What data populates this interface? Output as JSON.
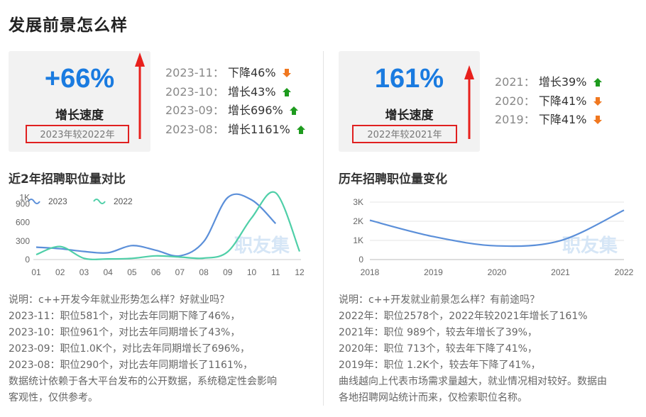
{
  "page_title": "发展前景怎么样",
  "left": {
    "stat": {
      "value": "+66%",
      "label": "增长速度",
      "compare": "2023年较2022年"
    },
    "trends": [
      {
        "period": "2023-11：",
        "text": "下降46%",
        "dir": "down"
      },
      {
        "period": "2023-10：",
        "text": "增长43%",
        "dir": "up"
      },
      {
        "period": "2023-09：",
        "text": "增长696%",
        "dir": "up"
      },
      {
        "period": "2023-08：",
        "text": "增长1161%",
        "dir": "up"
      }
    ],
    "section_title": "近2年招聘职位量对比",
    "description": [
      "说明：c++开发今年就业形势怎么样？好就业吗？",
      "2023-11：职位581个，对比去年同期下降了46%，",
      "2023-10：职位961个，对比去年同期增长了43%，",
      "2023-09：职位1.0K个，对比去年同期增长了696%，",
      "2023-08：职位290个，对比去年同期增长了1161%，",
      "数据统计依赖于各大平台发布的公开数据，系统稳定性会影响",
      "客观性，仅供参考。"
    ]
  },
  "right": {
    "stat": {
      "value": "161%",
      "label": "增长速度",
      "compare": "2022年较2021年"
    },
    "trends": [
      {
        "period": "2021：",
        "text": "增长39%",
        "dir": "up"
      },
      {
        "period": "2020：",
        "text": "下降41%",
        "dir": "down"
      },
      {
        "period": "2019：",
        "text": "下降41%",
        "dir": "down"
      }
    ],
    "section_title": "历年招聘职位量变化",
    "description": [
      "说明：c++开发就业前景怎么样？有前途吗？",
      "2022年：职位2578个，2022年较2021年增长了161%",
      "2021年：职位 989个，较去年增长了39%，",
      "2020年：职位 713个，较去年下降了41%，",
      "2019年：职位 1.2K个，较去年下降了41%，",
      "曲线越向上代表市场需求量越大，就业情况相对较好。数据由",
      "各地招聘网站统计而来，仅检索职位名称。"
    ]
  },
  "colors": {
    "up": "#1e9b1e",
    "down": "#f07820",
    "accent": "#1a7be0",
    "series_2023": "#5b8fd9",
    "series_2022": "#4fcfa8"
  },
  "watermark": "职友集",
  "chart_data": [
    {
      "type": "line",
      "title": "近2年招聘职位量对比",
      "categories": [
        "01",
        "02",
        "03",
        "04",
        "05",
        "06",
        "07",
        "08",
        "09",
        "10",
        "11",
        "12"
      ],
      "series": [
        {
          "name": "2023",
          "values": [
            200,
            175,
            130,
            110,
            225,
            150,
            60,
            290,
            1000,
            961,
            581,
            null
          ]
        },
        {
          "name": "2022",
          "values": [
            80,
            210,
            20,
            10,
            20,
            60,
            40,
            23,
            126,
            672,
            1076,
            130
          ]
        }
      ],
      "y_ticks": [
        "0",
        "300",
        "600",
        "900",
        "1K"
      ],
      "ylim": [
        0,
        1200
      ],
      "grid": false,
      "legend_position": "top-left"
    },
    {
      "type": "line",
      "title": "历年招聘职位量变化",
      "categories": [
        "2018",
        "2019",
        "2020",
        "2021",
        "2022"
      ],
      "series": [
        {
          "values": [
            2050,
            1200,
            713,
            989,
            2578
          ]
        }
      ],
      "y_ticks": [
        "0",
        "1K",
        "2K",
        "3K"
      ],
      "ylim": [
        0,
        3000
      ],
      "grid": true,
      "legend_position": "none"
    }
  ]
}
